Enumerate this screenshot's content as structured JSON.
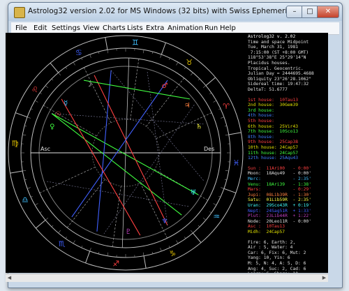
{
  "window": {
    "title": "Astrolog32 version 2.02 for MS Windows (32 bits) with Swiss Ephemeris v. 1.70",
    "min_label": "–",
    "max_label": "□",
    "close_label": "✕"
  },
  "menu": [
    "File",
    "Edit",
    "Settings",
    "View",
    "Charts",
    "Lists",
    "Extra",
    "Animation",
    "Run",
    "Help"
  ],
  "sidebar": {
    "header": [
      {
        "text": "Astrolog32 v. 2.02",
        "color": "#ffffff"
      },
      {
        "text": "Time and space Midpoint",
        "color": "#e0e0e0"
      },
      {
        "text": "Tue, March 31, 1981",
        "color": "#e0e0e0"
      },
      {
        "text": " 7:15:00 (ST +8:00 GMT)",
        "color": "#e0e0e0"
      },
      {
        "text": "118°53'38\"E 25°29'14\"N",
        "color": "#e0e0e0"
      },
      {
        "text": "Placidus houses.",
        "color": "#e0e0e0"
      },
      {
        "text": "Tropical. Geocentric.",
        "color": "#e0e0e0"
      },
      {
        "text": "Julian Day = 2444695.4688",
        "color": "#e0e0e0"
      },
      {
        "text": "Obliquity 23°26'28.1062\"",
        "color": "#e0e0e0"
      },
      {
        "text": "Sidereal time: 19:47:32",
        "color": "#e0e0e0"
      },
      {
        "text": "DeltaT: 51.6777",
        "color": "#e0e0e0"
      }
    ],
    "houses": [
      {
        "text": "1st house:  10Tau13",
        "color": "#ff4040"
      },
      {
        "text": "2nd house:  30Gem39",
        "color": "#e0e000"
      },
      {
        "text": "3rd house:  ",
        "color": "#40ff40"
      },
      {
        "text": "4th house:  ",
        "color": "#4080ff"
      },
      {
        "text": "5th house:  ",
        "color": "#ff4040"
      },
      {
        "text": "6th house:  25Vir43",
        "color": "#e0e000"
      },
      {
        "text": "7th house:  10Sco13",
        "color": "#40ff40"
      },
      {
        "text": "8th house:  ",
        "color": "#4080ff"
      },
      {
        "text": "9th house:  25Cap38",
        "color": "#ff4040"
      },
      {
        "text": "10th house: 24Cap57",
        "color": "#e0e000"
      },
      {
        "text": "11th house: 24Cap57",
        "color": "#40ff40"
      },
      {
        "text": "12th house: 25Aqu43",
        "color": "#4080ff"
      }
    ],
    "planets": [
      {
        "text": "Sun :  11Ari00   - 0:00'",
        "color": "#ff4040"
      },
      {
        "text": "Moon:  18Aqu49   - 0:00'",
        "color": "#e0e0e0"
      },
      {
        "text": "Merc:            - 2:35'",
        "color": "#40c0ff"
      },
      {
        "text": "Venu:  18Ari39   - 1:38'",
        "color": "#40ff40"
      },
      {
        "text": "Mars:            - 0:29'",
        "color": "#ff4040"
      },
      {
        "text": "Jupi:  08Lib39R  - 1:30'",
        "color": "#ff8040"
      },
      {
        "text": "Satu:  01Lib59R  - 2:35'",
        "color": "#ffff40"
      },
      {
        "text": "Uran:  29Sco43R  + 0:19'",
        "color": "#40ffff"
      },
      {
        "text": "Nept:  24Sag51R  + 1:33'",
        "color": "#4060ff"
      },
      {
        "text": "Plut:  23Lib44R  + 1:22'",
        "color": "#c040c0"
      },
      {
        "text": "Node:  20Leo11R  - 0:00'",
        "color": "#e0e0e0"
      },
      {
        "text": "Asc :  10Tau13",
        "color": "#ff4040"
      },
      {
        "text": "Midh:  24Cap57",
        "color": "#e0e000"
      }
    ],
    "stats": [
      {
        "text": "Fire: 6, Earth: 2,",
        "color": "#e0e0e0"
      },
      {
        "text": "Air : 5, Water: 4",
        "color": "#e0e0e0"
      },
      {
        "text": "Car: 6, Fix: 6, Mut: 2",
        "color": "#e0e0e0"
      },
      {
        "text": "Yang: 10, Yin: 6",
        "color": "#e0e0e0"
      },
      {
        "text": "M: 5, N: 4, A: 5, D: 6",
        "color": "#e0e0e0"
      },
      {
        "text": "Ang: 4, Suc: 2, Cad: 6",
        "color": "#e0e0e0"
      },
      {
        "text": "Learn: 6, Share: 10",
        "color": "#e0e0e0"
      }
    ]
  },
  "chart": {
    "house_labels": [
      "Asc",
      "Des"
    ],
    "colors": {
      "outer_ring": "#c0c0c0",
      "fire": "#ff4040",
      "earth": "#e0c000",
      "air": "#40c0ff",
      "water": "#4060ff",
      "aspect_green": "#40ff40",
      "aspect_blue": "#4060ff",
      "aspect_red": "#ff4040",
      "aspect_dim": "#8080a0"
    },
    "sign_glyphs": [
      "♈",
      "♉",
      "♊",
      "♋",
      "♌",
      "♍",
      "♎",
      "♏",
      "♐",
      "♑",
      "♒",
      "♓"
    ],
    "planet_glyphs": [
      {
        "glyph": "☉",
        "color": "#ff4040"
      },
      {
        "glyph": "☽",
        "color": "#e0e0e0"
      },
      {
        "glyph": "☿",
        "color": "#40c0ff"
      },
      {
        "glyph": "♀",
        "color": "#40ff40"
      },
      {
        "glyph": "♂",
        "color": "#ff4040"
      },
      {
        "glyph": "♃",
        "color": "#ff8040"
      },
      {
        "glyph": "♄",
        "color": "#ffff40"
      },
      {
        "glyph": "♅",
        "color": "#40ffff"
      },
      {
        "glyph": "♆",
        "color": "#4060ff"
      },
      {
        "glyph": "♇",
        "color": "#c040c0"
      }
    ]
  }
}
